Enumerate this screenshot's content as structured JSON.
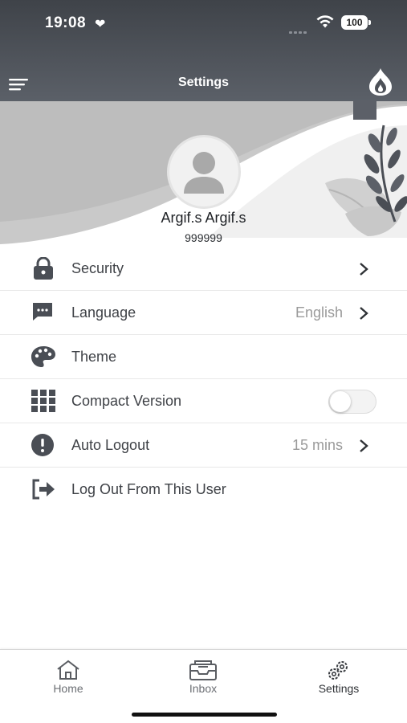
{
  "status_bar": {
    "time": "19:08",
    "battery": "100"
  },
  "header": {
    "title": "Settings",
    "menu_icon": "hamburger-menu-icon",
    "logo_icon": "flame-logo-icon"
  },
  "profile": {
    "name": "Argif.s Argif.s",
    "id": "999999"
  },
  "settings": {
    "security": {
      "label": "Security",
      "icon": "lock-icon"
    },
    "language": {
      "label": "Language",
      "value": "English",
      "icon": "chat-icon"
    },
    "theme": {
      "label": "Theme",
      "icon": "palette-icon",
      "swatch_color": "#5c6068"
    },
    "compact": {
      "label": "Compact Version",
      "icon": "grid-icon",
      "enabled": false
    },
    "auto_logout": {
      "label": "Auto Logout",
      "value": "15 mins",
      "icon": "alert-icon"
    },
    "logout": {
      "label": "Log Out From This User",
      "icon": "logout-icon"
    }
  },
  "tabbar": {
    "home": "Home",
    "inbox": "Inbox",
    "settings": "Settings"
  },
  "colors": {
    "header": "#4a4e55",
    "accent": "#5c6068"
  }
}
